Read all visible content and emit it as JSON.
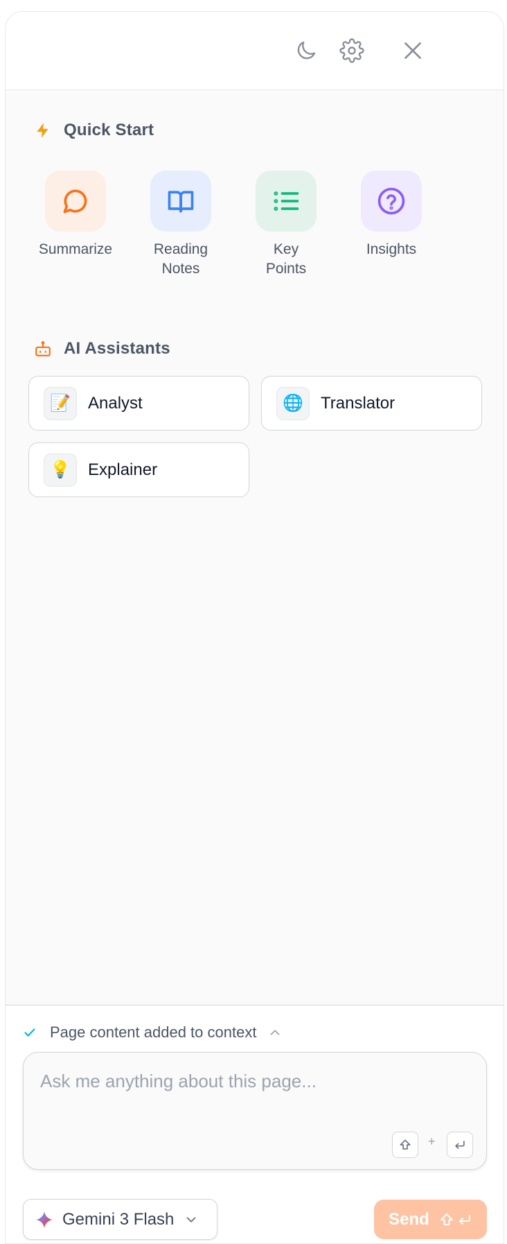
{
  "header": {
    "dark_mode_icon": "moon-icon",
    "settings_icon": "gear-icon",
    "close_icon": "close-icon"
  },
  "quick_start": {
    "title": "Quick Start",
    "icon": "lightning-icon",
    "accent": "#f59e0b",
    "items": [
      {
        "label": "Summarize",
        "icon": "chat-bubble-icon",
        "color": "#f97316",
        "bg": "#fdeee6"
      },
      {
        "label": "Reading\nNotes",
        "icon": "book-open-icon",
        "color": "#3b82f6",
        "bg": "#e6eefd"
      },
      {
        "label": "Key\nPoints",
        "icon": "list-icon",
        "color": "#10b981",
        "bg": "#e3f3ec"
      },
      {
        "label": "Insights",
        "icon": "question-circle-icon",
        "color": "#8b5cf6",
        "bg": "#efeafd"
      }
    ]
  },
  "ai_assistants": {
    "title": "AI Assistants",
    "icon": "robot-icon",
    "items": [
      {
        "name": "Analyst",
        "emoji": "📝"
      },
      {
        "name": "Translator",
        "emoji": "🌐"
      },
      {
        "name": "Explainer",
        "emoji": "💡"
      }
    ]
  },
  "footer": {
    "context_status": "Page content added to context",
    "input_placeholder": "Ask me anything about this page...",
    "shortcut_plus": "+",
    "model_name": "Gemini 3 Flash",
    "send_label": "Send",
    "send_color": "#fdc3a3"
  }
}
